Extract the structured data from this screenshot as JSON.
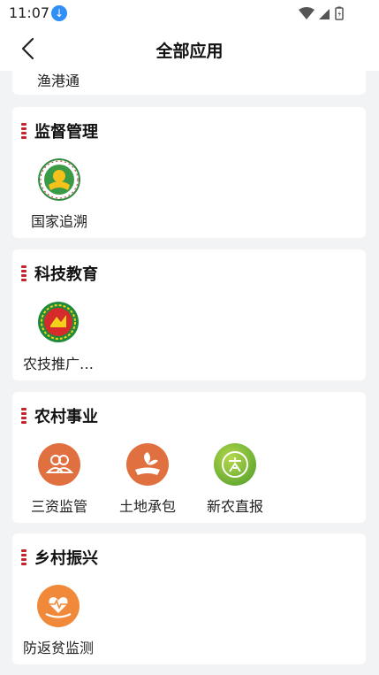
{
  "status": {
    "time": "11:07"
  },
  "nav": {
    "title": "全部应用"
  },
  "sections": {
    "partial": {
      "apps": [
        {
          "label": "渔港通"
        }
      ]
    },
    "supervision": {
      "title": "监督管理",
      "apps": [
        {
          "label": "国家追溯",
          "icon": "traceability-seal-icon"
        }
      ]
    },
    "education": {
      "title": "科技教育",
      "apps": [
        {
          "label": "农技推广…",
          "icon": "agri-extension-emblem-icon"
        }
      ]
    },
    "rural": {
      "title": "农村事业",
      "apps": [
        {
          "label": "三资监管",
          "icon": "people-supervision-icon"
        },
        {
          "label": "土地承包",
          "icon": "land-contract-icon"
        },
        {
          "label": "新农直报",
          "icon": "xinnong-report-icon"
        }
      ]
    },
    "revival": {
      "title": "乡村振兴",
      "apps": [
        {
          "label": "防返贫监测",
          "icon": "heart-monitor-icon"
        }
      ]
    }
  },
  "colors": {
    "accent_mark": "#c0272d",
    "orange": "#e07040",
    "green": "#4a9a2a"
  }
}
